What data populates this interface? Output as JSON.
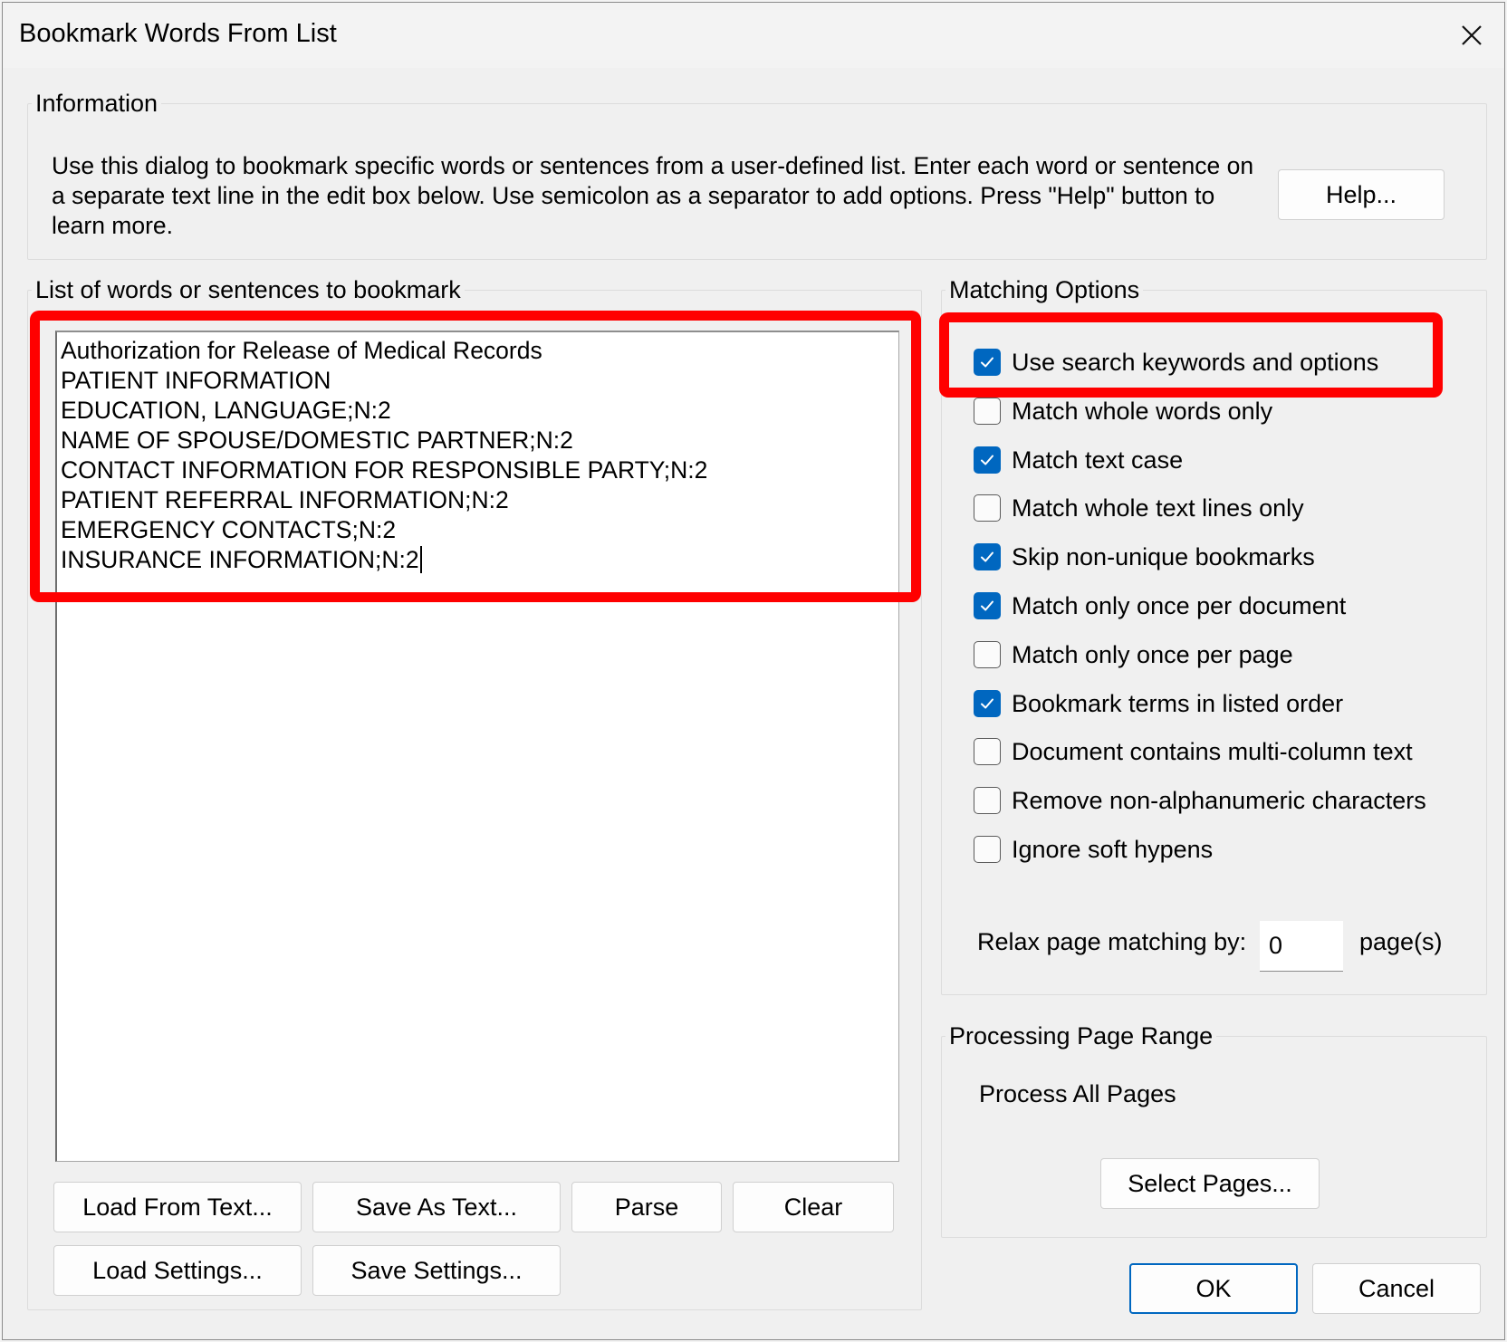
{
  "window": {
    "title": "Bookmark Words From List"
  },
  "information": {
    "legend": "Information",
    "text": "Use this dialog to bookmark specific words or sentences from a user-defined list. Enter each word or sentence on a separate text line in the edit box below. Use semicolon as a separator to add options. Press \"Help\" button to learn more.",
    "help_button": "Help..."
  },
  "word_list": {
    "legend": "List of words or sentences to bookmark",
    "lines": [
      "Authorization for Release of Medical Records",
      "PATIENT INFORMATION",
      "EDUCATION, LANGUAGE;N:2",
      "NAME OF SPOUSE/DOMESTIC PARTNER;N:2",
      "CONTACT INFORMATION FOR RESPONSIBLE PARTY;N:2",
      "PATIENT REFERRAL INFORMATION;N:2",
      "EMERGENCY CONTACTS;N:2",
      "INSURANCE INFORMATION;N:2"
    ],
    "buttons": {
      "load_text": "Load From Text...",
      "save_text": "Save As Text...",
      "parse": "Parse",
      "clear": "Clear",
      "load_settings": "Load Settings...",
      "save_settings": "Save Settings..."
    }
  },
  "matching": {
    "legend": "Matching Options",
    "options": [
      {
        "label": "Use search keywords and options",
        "checked": true
      },
      {
        "label": "Match whole words only",
        "checked": false
      },
      {
        "label": "Match text case",
        "checked": true
      },
      {
        "label": "Match whole text lines only",
        "checked": false
      },
      {
        "label": "Skip non-unique bookmarks",
        "checked": true
      },
      {
        "label": "Match only once per document",
        "checked": true
      },
      {
        "label": "Match only once per page",
        "checked": false
      },
      {
        "label": "Bookmark terms in listed order",
        "checked": true
      },
      {
        "label": "Document contains multi-column text",
        "checked": false
      },
      {
        "label": "Remove non-alphanumeric characters",
        "checked": false
      },
      {
        "label": "Ignore soft hypens",
        "checked": false
      }
    ],
    "relax_label": "Relax page matching by:",
    "relax_value": "0",
    "relax_unit": "page(s)"
  },
  "page_range": {
    "legend": "Processing Page Range",
    "status": "Process All Pages",
    "select_button": "Select Pages..."
  },
  "footer": {
    "ok": "OK",
    "cancel": "Cancel"
  },
  "colors": {
    "accent": "#0067c0",
    "highlight": "#ff0000"
  }
}
